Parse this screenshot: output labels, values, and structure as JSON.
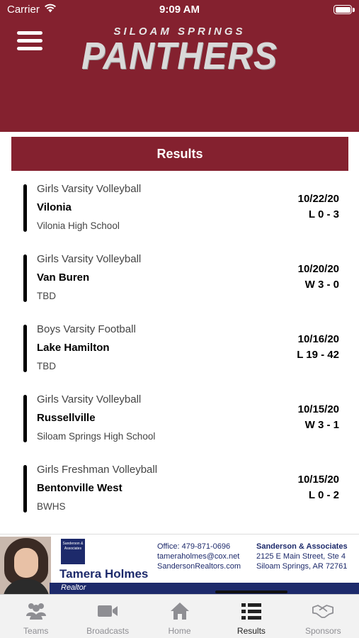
{
  "status_bar": {
    "carrier": "Carrier",
    "time": "9:09 AM"
  },
  "header": {
    "logo_top": "SILOAM SPRINGS",
    "logo_main": "PANTHERS",
    "bg_color": "#84212f"
  },
  "section": {
    "title": "Results"
  },
  "results": [
    {
      "sport": "Girls Varsity Volleyball",
      "opponent": "Vilonia",
      "venue": "Vilonia High School",
      "date": "10/22/20",
      "score": "L 0 - 3"
    },
    {
      "sport": "Girls Varsity Volleyball",
      "opponent": "Van Buren",
      "venue": "TBD",
      "date": "10/20/20",
      "score": "W 3 - 0"
    },
    {
      "sport": "Boys Varsity Football",
      "opponent": "Lake Hamilton",
      "venue": "TBD",
      "date": "10/16/20",
      "score": "L 19 - 42"
    },
    {
      "sport": "Girls Varsity Volleyball",
      "opponent": "Russellville",
      "venue": "Siloam Springs High School",
      "date": "10/15/20",
      "score": "W 3 - 1"
    },
    {
      "sport": "Girls Freshman Volleyball",
      "opponent": "Bentonville West",
      "venue": "BWHS",
      "date": "10/15/20",
      "score": "L 0 - 2"
    }
  ],
  "sponsor": {
    "agent_name": "Tamera Holmes",
    "agent_title": "Realtor",
    "office": "Office: 479-871-0696",
    "email": "tameraholmes@cox.net",
    "website": "SandersonRealtors.com",
    "agency_name": "Sanderson & Associates",
    "address_line1": "2125 E Main Street, Ste 4",
    "address_line2": "Siloam Springs, AR 72761",
    "logo_text": "Sanderson & Associates"
  },
  "tabs": [
    {
      "label": "Teams",
      "icon": "teams-icon"
    },
    {
      "label": "Broadcasts",
      "icon": "video-camera-icon"
    },
    {
      "label": "Home",
      "icon": "home-icon"
    },
    {
      "label": "Results",
      "icon": "list-icon",
      "active": true
    },
    {
      "label": "Sponsors",
      "icon": "handshake-icon"
    }
  ]
}
